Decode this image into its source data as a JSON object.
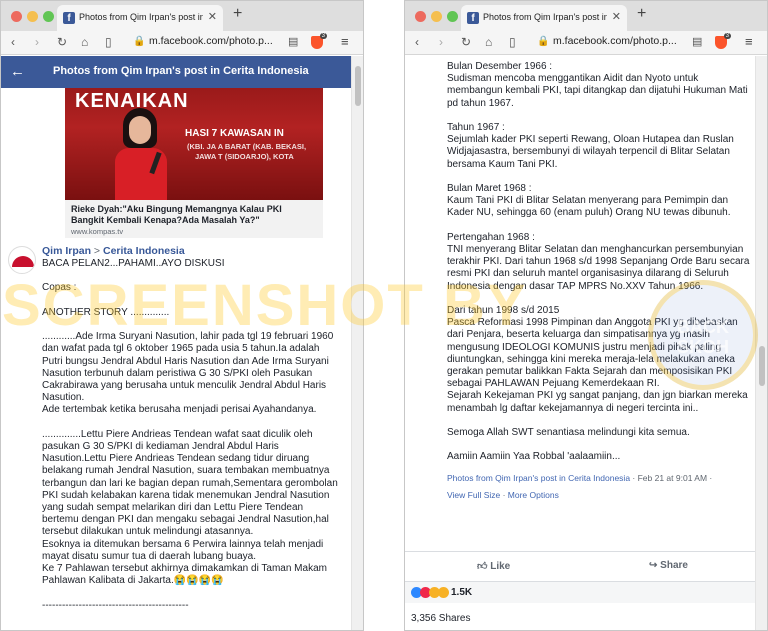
{
  "browser": {
    "tab_title": "Photos from Qim Irpan's post in C",
    "url": "m.facebook.com/photo.p...",
    "shield_count": "3"
  },
  "left": {
    "header_title": "Photos from Qim Irpan's post in Cerita Indonesia",
    "image": {
      "banner_top": "KENAIKAN",
      "banner_mid": "HASI    7 KAWASAN IN",
      "banner_l3": "(KBI. JA       A BARAT (KAB. BEKASI,",
      "banner_l4": "JAWA T       (SIDOARJO), KOTA",
      "caption_title": "Rieke Dyah:\"Aku Bingung Memangnya Kalau PKI Bangkit Kembali Kenapa?Ada Masalah Ya?\"",
      "caption_source": "www.kompas.tv"
    },
    "post": {
      "author": "Qim Irpan",
      "separator": " > ",
      "group": "Cerita Indonesia",
      "paragraphs": [
        "BACA PELAN2...PAHAMI..AYO DISKUSI",
        "Copas :",
        "ANOTHER STORY ..............",
        "............Ade Irma Suryani Nasution, lahir pada tgl 19 februari 1960 dan wafat pada tgl 6 oktober 1965 pada usia 5 tahun.Ia adalah Putri bungsu Jendral Abdul Haris Nasution dan Ade Irma Suryani Nasution terbunuh dalam peristiwa G 30 S/PKI oleh Pasukan Cakrabirawa yang berusaha untuk menculik Jendral Abdul Haris Nasution.\nAde tertembak ketika berusaha menjadi perisai Ayahandanya.",
        "..............Lettu Piere Andrieas Tendean wafat saat diculik oleh pasukan G 30 S/PKI di kediaman Jendral Abdul Haris Nasution.Lettu Piere Andrieas Tendean sedang tidur diruang belakang rumah Jendral Nasution, suara tembakan membuatnya terbangun dan lari ke bagian depan rumah,Sementara gerombolan PKI sudah kelabakan karena tidak menemukan Jendral Nasution yang sudah sempat melarikan diri dan Lettu Piere Tendean bertemu dengan PKI dan mengaku sebagai Jendral Nasution,hal tersebut dilakukan untuk melindungi atasannya.\nEsoknya ia ditemukan bersama 6 Perwira lainnya telah menjadi mayat disatu sumur tua di daerah lubang buaya.\nKe 7 Pahlawan tersebut akhirnya dimakamkan di Taman Makam Pahlawan Kalibata di Jakarta.😭😭😭😭",
        "--------------------------------------------"
      ]
    }
  },
  "right": {
    "paragraphs": [
      "Bulan Desember 1966 :\nSudisman mencoba menggantikan Aidit dan Nyoto untuk membangun kembali PKI, tapi ditangkap dan dijatuhi Hukuman Mati pd tahun 1967.",
      "Tahun 1967 :\nSejumlah kader PKI seperti Rewang, Oloan Hutapea dan Ruslan Widjajasastra, bersembunyi di wilayah terpencil di Blitar Selatan bersama Kaum Tani PKI.",
      "Bulan Maret 1968 :\nKaum Tani PKI di Blitar Selatan menyerang para Pemimpin dan Kader NU, sehingga 60 (enam puluh) Orang NU tewas dibunuh.",
      "Pertengahan 1968 :\nTNI menyerang Blitar Selatan dan menghancurkan persembunyian terakhir PKI. Dari tahun 1968 s/d 1998 Sepanjang Orde Baru secara resmi PKI dan seluruh mantel organisasinya dilarang di Seluruh Indonesia dengan dasar TAP MPRS No.XXV Tahun 1966.",
      "Dari tahun 1998 s/d 2015\nPasca Reformasi 1998 Pimpinan dan Anggota PKI yg dibebaskan dari Penjara, beserta keluarga dan simpatisannya yg masih mengusung IDEOLOGI KOMUNIS justru menjadi pihak paling diuntungkan, sehingga kini mereka meraja-lela melakukan aneka gerakan pemutar balikkan Fakta Sejarah dan memposisikan PKI sebagai PAHLAWAN Pejuang Kemerdekaan RI.\nSejarah Kekejaman PKI yg sangat panjang, dan jgn biarkan mereka menambah lg daftar kekejamannya di negeri tercinta ini..",
      "Semoga Allah SWT senantiasa melindungi kita semua.",
      "Aamiin Aamiin Yaa Robbal 'aalaamiin..."
    ],
    "meta_link": "Photos from Qim Irpan's post in Cerita Indonesia",
    "meta_time": " · Feb 21 at 9:01 AM · ",
    "view_full": "View Full Size",
    "meta_sep": " · ",
    "more_options": "More Options",
    "like_label": "Like",
    "share_label": "Share",
    "reaction_count": "1.5K",
    "shares": "3,356 Shares"
  },
  "overlay": {
    "watermark": "SCREENSHOT BY",
    "stamp": "BACK SKOH"
  },
  "colors": {
    "fb_blue": "#3b5998",
    "link_blue": "#4267b2",
    "brave_orange": "#fb542b"
  }
}
